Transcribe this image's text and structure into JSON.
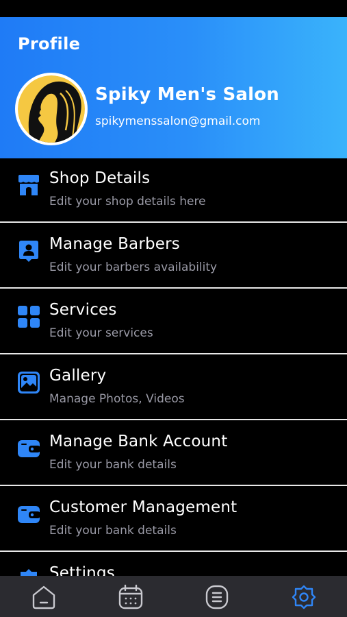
{
  "header": {
    "title": "Profile",
    "name": "Spiky Men's Salon",
    "email": "spikymenssalon@gmail.com"
  },
  "menu": {
    "items": [
      {
        "title": "Shop Details",
        "subtitle": "Edit your shop details here",
        "icon": "store-icon"
      },
      {
        "title": "Manage Barbers",
        "subtitle": "Edit your barbers availability",
        "icon": "user-badge-icon"
      },
      {
        "title": "Services",
        "subtitle": "Edit your services",
        "icon": "grid-icon"
      },
      {
        "title": "Gallery",
        "subtitle": "Manage Photos, Videos",
        "icon": "image-icon"
      },
      {
        "title": "Manage Bank Account",
        "subtitle": "Edit your bank details",
        "icon": "wallet-icon"
      },
      {
        "title": "Customer Management",
        "subtitle": "Edit your bank details",
        "icon": "wallet-icon"
      },
      {
        "title": "Settings",
        "icon": "settings-icon"
      }
    ]
  },
  "bottom_nav": {
    "items": [
      "home-icon",
      "calendar-icon",
      "list-icon",
      "settings-icon"
    ],
    "active": "settings-icon"
  },
  "colors": {
    "accent": "#2f86f7",
    "header_start": "#1f7bf6",
    "header_end": "#3ab3fb",
    "nav_bg": "#2b2b30",
    "nav_icon": "#c9c9cf",
    "avatar_yellow": "#f5c842"
  }
}
